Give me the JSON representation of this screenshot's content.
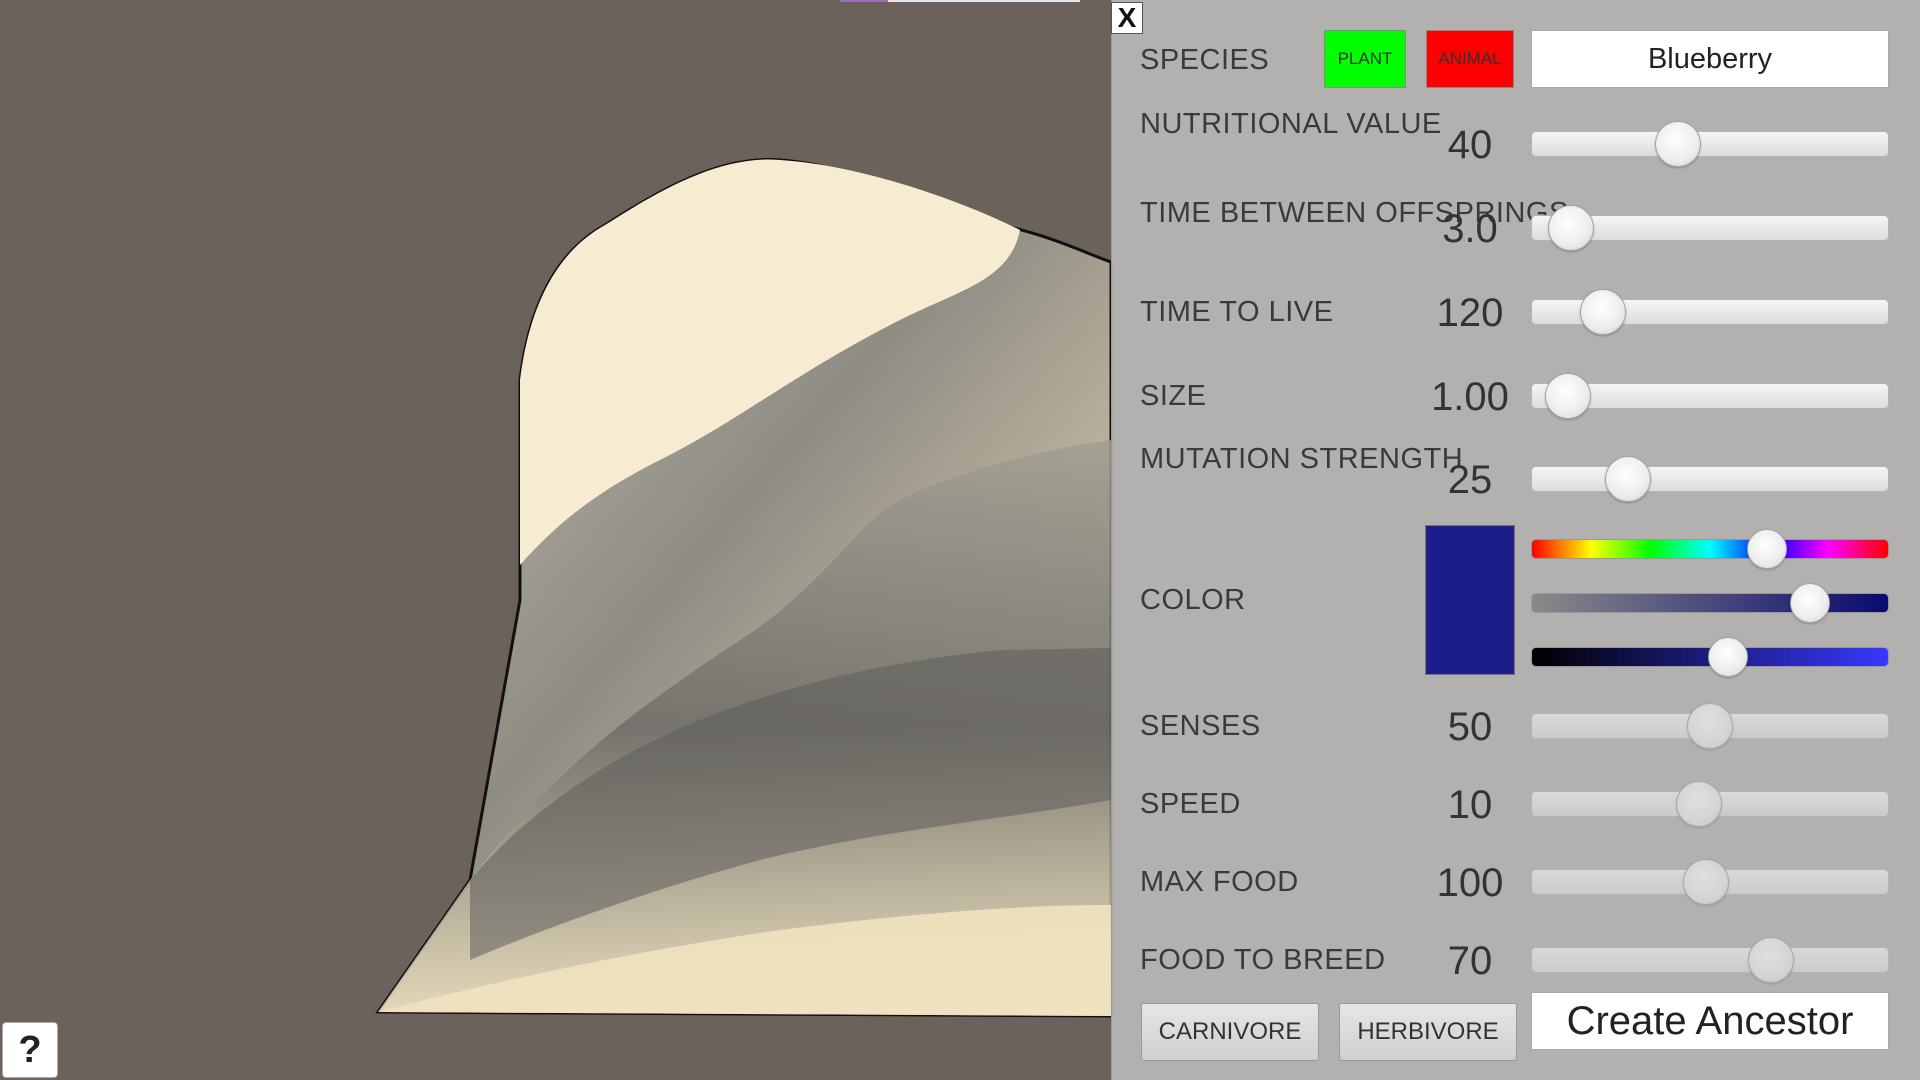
{
  "panel": {
    "close_label": "X",
    "species": {
      "label": "SPECIES",
      "plant_label": "PLANT",
      "animal_label": "ANIMAL",
      "name": "Blueberry",
      "plant_color": "#00ff00",
      "animal_color": "#ff0000"
    },
    "sliders": [
      {
        "label": "NUTRITIONAL VALUE",
        "value_text": "40",
        "position": 0.41
      },
      {
        "label": "TIME BETWEEN OFFSPRINGS",
        "value_text": "3.0",
        "position": 0.11
      },
      {
        "label": "TIME TO LIVE",
        "value_text": "120",
        "position": 0.2
      },
      {
        "label": "SIZE",
        "value_text": "1.00",
        "position": 0.1
      },
      {
        "label": "MUTATION STRENGTH",
        "value_text": "25",
        "position": 0.27
      }
    ],
    "color": {
      "label": "COLOR",
      "swatch": "#1c1c8a",
      "hue": 0.66,
      "saturation": 0.78,
      "brightness": 0.55
    },
    "animal_sliders": [
      {
        "label": "SENSES",
        "value_text": "50",
        "position": 0.5
      },
      {
        "label": "SPEED",
        "value_text": "10",
        "position": 0.47
      },
      {
        "label": "MAX FOOD",
        "value_text": "100",
        "position": 0.49
      },
      {
        "label": "FOOD TO BREED",
        "value_text": "70",
        "position": 0.67
      }
    ],
    "carnivore_label": "CARNIVORE",
    "herbivore_label": "HERBIVORE",
    "create_label": "Create Ancestor"
  },
  "help_label": "?"
}
